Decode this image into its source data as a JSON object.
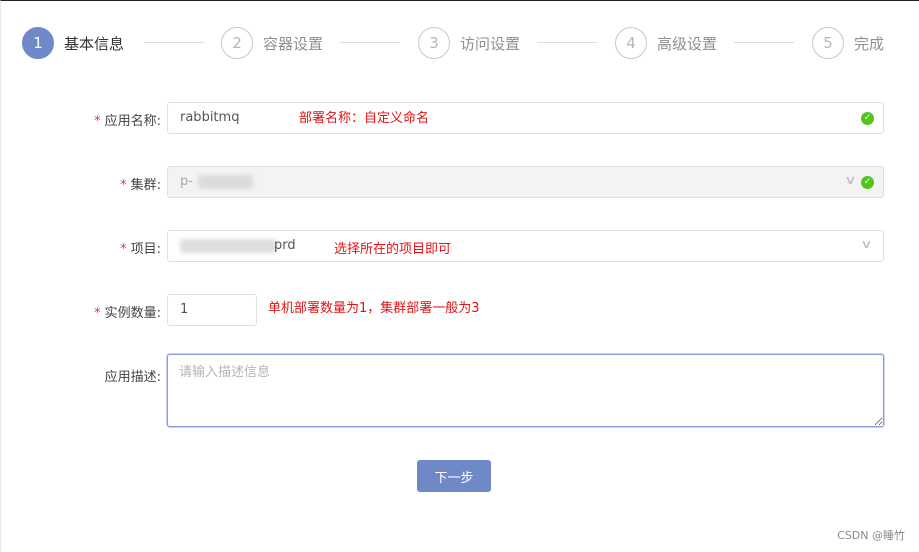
{
  "steps": [
    {
      "num": "1",
      "label": "基本信息",
      "active": true
    },
    {
      "num": "2",
      "label": "容器设置",
      "active": false
    },
    {
      "num": "3",
      "label": "访问设置",
      "active": false
    },
    {
      "num": "4",
      "label": "高级设置",
      "active": false
    },
    {
      "num": "5",
      "label": "完成",
      "active": false
    }
  ],
  "form": {
    "required_mark": "*",
    "app_name": {
      "label": "应用名称:",
      "value": "rabbitmq",
      "note": "部署名称：自定义命名"
    },
    "cluster": {
      "label": "集群:",
      "value": "p-"
    },
    "project": {
      "label": "项目:",
      "value": "prd",
      "note": "选择所在的项目即可"
    },
    "instances": {
      "label": "实例数量:",
      "value": "1",
      "note": "单机部署数量为1，集群部署一般为3"
    },
    "description": {
      "label": "应用描述:",
      "placeholder": "请输入描述信息"
    }
  },
  "next_button": "下一步",
  "watermark": "CSDN @睡竹",
  "colors": {
    "primary": "#6f89c8",
    "success": "#52c41a",
    "annotation": "#e01414",
    "required": "#e23b3b"
  }
}
